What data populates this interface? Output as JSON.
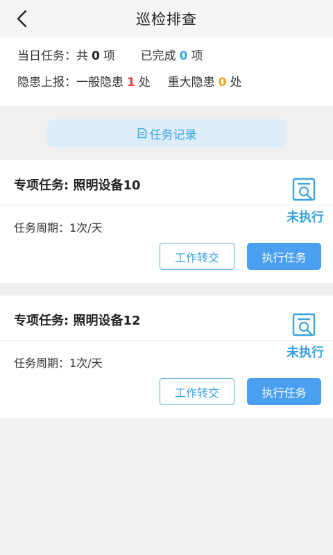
{
  "header": {
    "title": "巡检排查",
    "back_icon": "chevron-left-icon"
  },
  "summary": {
    "today_label": "当日任务：共",
    "today_count": "0",
    "today_unit": "项",
    "done_label": "已完成",
    "done_count": "0",
    "done_unit": "项",
    "hazard_label": "隐患上报：一般隐患",
    "general_count": "1",
    "general_unit": "处",
    "major_label": "重大隐患",
    "major_count": "0",
    "major_unit": "处"
  },
  "record_button": {
    "label": "任务记录",
    "icon": "document-icon"
  },
  "tasks": [
    {
      "title": "专项任务: 照明设备10",
      "status": "未执行",
      "cycle": "任务周期：1次/天",
      "transfer_label": "工作转交",
      "execute_label": "执行任务"
    },
    {
      "title": "专项任务: 照明设备12",
      "status": "未执行",
      "cycle": "任务周期：1次/天",
      "transfer_label": "工作转交",
      "execute_label": "执行任务"
    }
  ],
  "colors": {
    "accent": "#3aa3de",
    "primary_button": "#4a9ff0",
    "danger": "#e23b3b",
    "warning": "#f0a020",
    "record_bg": "#dcedf9"
  }
}
